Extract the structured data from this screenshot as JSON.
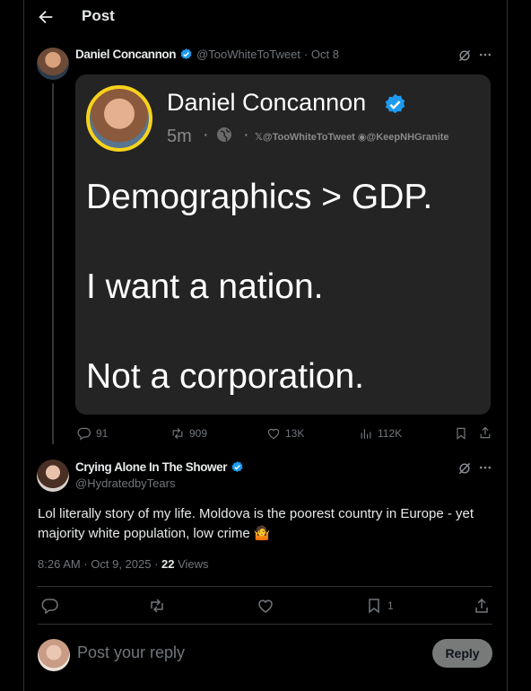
{
  "header": {
    "title": "Post"
  },
  "quoted_post": {
    "author_name": "Daniel Concannon",
    "author_handle": "@TooWhiteToTweet",
    "date": "· Oct 8",
    "card": {
      "name": "Daniel Concannon",
      "time": "5m",
      "dot": "·",
      "handles": "𝕏@TooWhiteToTweet ◉@KeepNHGranite",
      "line1": "Demographics > GDP.",
      "line2": "I want a nation.",
      "line3": "Not a corporation."
    },
    "stats": {
      "replies": "91",
      "reposts": "909",
      "likes": "13K",
      "views": "112K"
    }
  },
  "reply": {
    "author_name": "Crying Alone In The Shower",
    "author_handle": "@HydratedbyTears",
    "text": "Lol literally story of my life. Moldova is the poorest country in Europe - yet majority white population, low crime 🤷",
    "time": "8:26 AM · Oct 9, 2025 · ",
    "views_count": "22",
    "views_label": " Views",
    "bookmarks": "1"
  },
  "compose": {
    "placeholder": "Post your reply",
    "button": "Reply"
  },
  "colors": {
    "verified": "#1d9bf0",
    "accent_yellow": "#f7d21b",
    "muted": "#71767b"
  }
}
